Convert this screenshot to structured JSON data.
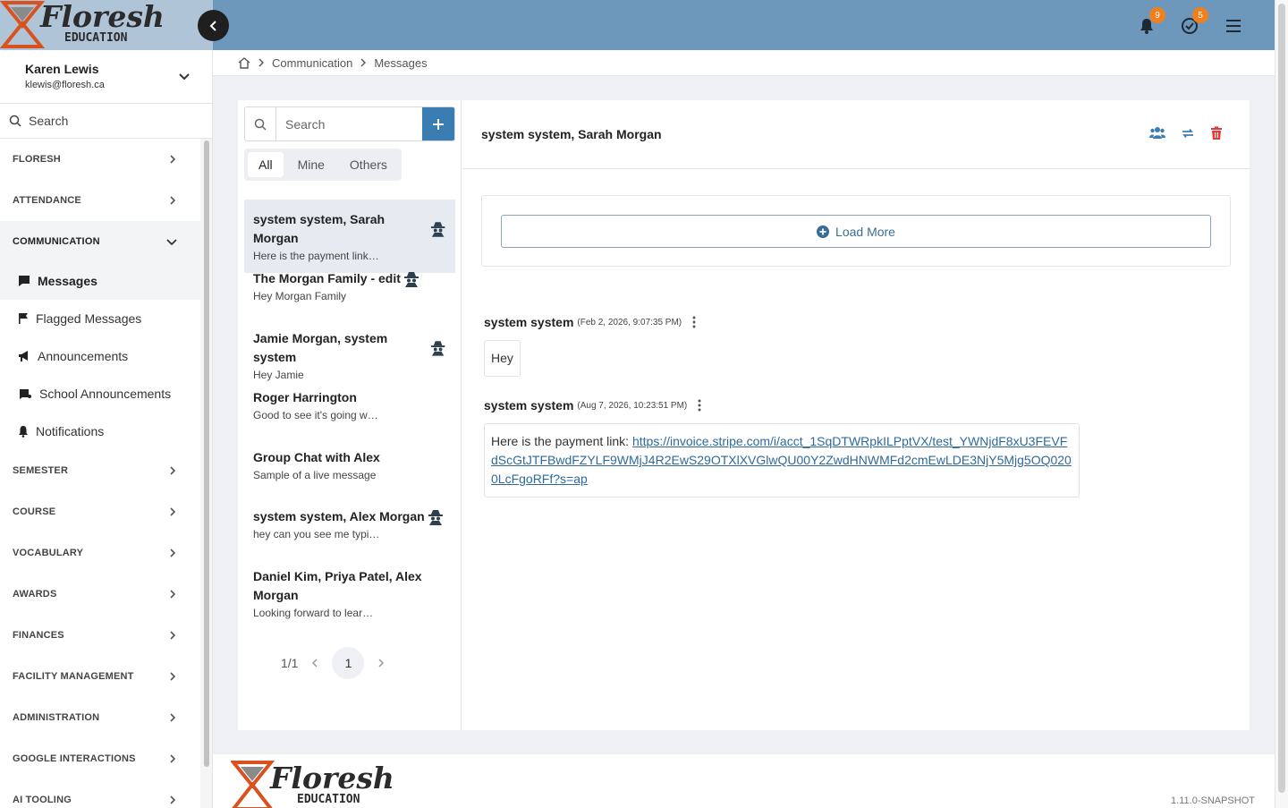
{
  "brand": {
    "name": "Floresh",
    "tagline": "EDUCATION"
  },
  "header": {
    "notifications_count": "9",
    "tasks_count": "5"
  },
  "user": {
    "name": "Karen Lewis",
    "email": "klewis@floresh.ca"
  },
  "sidebar": {
    "search_label": "Search",
    "sections": [
      {
        "label": "FLORESH"
      },
      {
        "label": "ATTENDANCE"
      },
      {
        "label": "COMMUNICATION"
      },
      {
        "label": "SEMESTER"
      },
      {
        "label": "COURSE"
      },
      {
        "label": "VOCABULARY"
      },
      {
        "label": "AWARDS"
      },
      {
        "label": "FINANCES"
      },
      {
        "label": "FACILITY MANAGEMENT"
      },
      {
        "label": "ADMINISTRATION"
      },
      {
        "label": "GOOGLE INTERACTIONS"
      },
      {
        "label": "AI TOOLING"
      }
    ],
    "communication_items": [
      {
        "label": "Messages"
      },
      {
        "label": "Flagged Messages"
      },
      {
        "label": "Announcements"
      },
      {
        "label": "School Announcements"
      },
      {
        "label": "Notifications"
      }
    ]
  },
  "breadcrumb": {
    "items": [
      "Communication",
      "Messages"
    ]
  },
  "list": {
    "search_placeholder": "Search",
    "tabs": [
      {
        "label": "All"
      },
      {
        "label": "Mine"
      },
      {
        "label": "Others"
      }
    ],
    "conversations": [
      {
        "title": "system system, Sarah Morgan",
        "preview": "Here is the payment link…"
      },
      {
        "title": "The Morgan Family - edit",
        "preview": "Hey Morgan Family"
      },
      {
        "title": "Jamie Morgan, system system",
        "preview": "Hey Jamie"
      },
      {
        "title": "Roger Harrington",
        "preview": "Good to see it's going w…"
      },
      {
        "title": "Group Chat with Alex",
        "preview": "Sample of a live message"
      },
      {
        "title": "system system, Alex Morgan",
        "preview": "hey can you see me typi…"
      },
      {
        "title": "Daniel Kim, Priya Patel, Alex Morgan",
        "preview": "Looking forward to lear…"
      }
    ],
    "pager": {
      "summary": "1/1",
      "current": "1"
    }
  },
  "detail": {
    "title": "system system, Sarah Morgan",
    "load_more": "Load More",
    "messages": [
      {
        "author": "system system",
        "time": "(Feb 2, 2026, 9:07:35 PM)",
        "text": "Hey"
      },
      {
        "author": "system system",
        "time": "(Aug 7, 2026, 10:23:51 PM)",
        "text": "Here is the payment link: ",
        "link": "https://invoice.stripe.com/i/acct_1SqDTWRpkILPptVX/test_YWNjdF8xU3FEVFdScGtJTFBwdFZYLF9WMjJ4R2EwS29OTXlXVGlwQU00Y2ZwdHNWMFd2cmEwLDE3NjY5Mjg5OQ0200LcFgoRFf?s=ap"
      }
    ]
  },
  "footer": {
    "version": "1.11.0-SNAPSHOT"
  },
  "colors": {
    "header": "#6e98bb",
    "accent": "#3a7db3",
    "badge": "#f0801e",
    "danger": "#e53935"
  }
}
